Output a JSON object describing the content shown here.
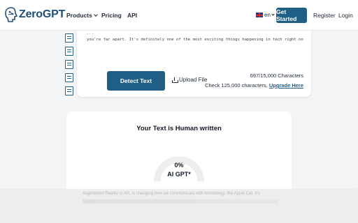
{
  "header": {
    "brand": "ZeroGPT",
    "nav": {
      "products": "Products",
      "pricing": "Pricing",
      "api": "API"
    },
    "language": "en",
    "get_started": "Get Started",
    "register": "Register",
    "login": "Login"
  },
  "side_tools": [
    "document-icon",
    "document-icon",
    "image-doc-icon",
    "edit-icon",
    "mail-icon"
  ],
  "editor": {
    "line1": "...",
    "line2": "you're far apart. It's definitely one of the most exciting things happening in tech right now."
  },
  "actions": {
    "detect": "Detect Text",
    "upload": "Upload File",
    "char_count": "697/15,000 Characters",
    "check_more": "Check 125,000 characters,",
    "upgrade": "Upgrade Here"
  },
  "result": {
    "title": "Your Text is Human written",
    "percent": "0%",
    "label": "AI GPT*",
    "ai_fraction": 0
  },
  "overlay_text": "Augmented Reality or AR, is changing how we communicate with technology, like Apple Cat. It's",
  "colors": {
    "brand": "#1f5f85",
    "gauge_track": "#eeeeee"
  }
}
